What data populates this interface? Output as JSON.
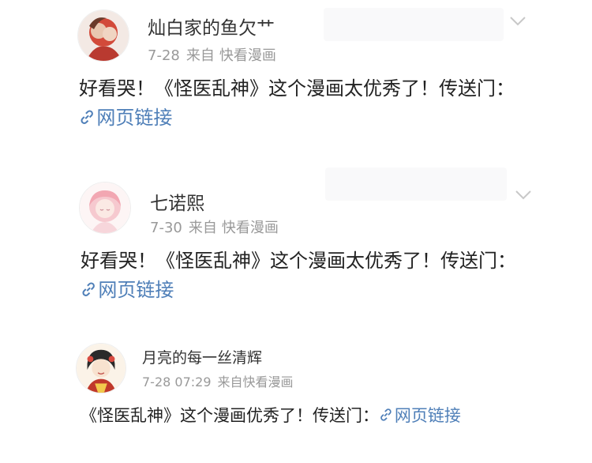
{
  "posts": [
    {
      "username": "灿白家的鱼欠艹",
      "date": "7-28",
      "source_label": "来自",
      "source": "快看漫画",
      "content_text": "好看哭！《怪医乱神》这个漫画太优秀了！传送门：",
      "link_text": "网页链接",
      "avatar_icon": "avatar-image",
      "link_icon": "link-icon",
      "menu_icon": "chevron-down-icon"
    },
    {
      "username": "七诺熙",
      "date": "7-30",
      "source_label": "来自",
      "source": "快看漫画",
      "content_text": "好看哭！《怪医乱神》这个漫画太优秀了！传送门：",
      "link_text": "网页链接",
      "avatar_icon": "avatar-image",
      "link_icon": "link-icon",
      "menu_icon": "chevron-down-icon"
    },
    {
      "username": "月亮的每一丝清辉",
      "date": "7-28 07:29",
      "source_label": "来自快看漫画",
      "content_text": "《怪医乱神》这个漫画优秀了！传送门：",
      "link_text": "网页链接",
      "avatar_icon": "avatar-image",
      "link_icon": "link-icon"
    }
  ],
  "colors": {
    "link": "#4f7fb8",
    "meta": "#999999",
    "text": "#222222"
  }
}
